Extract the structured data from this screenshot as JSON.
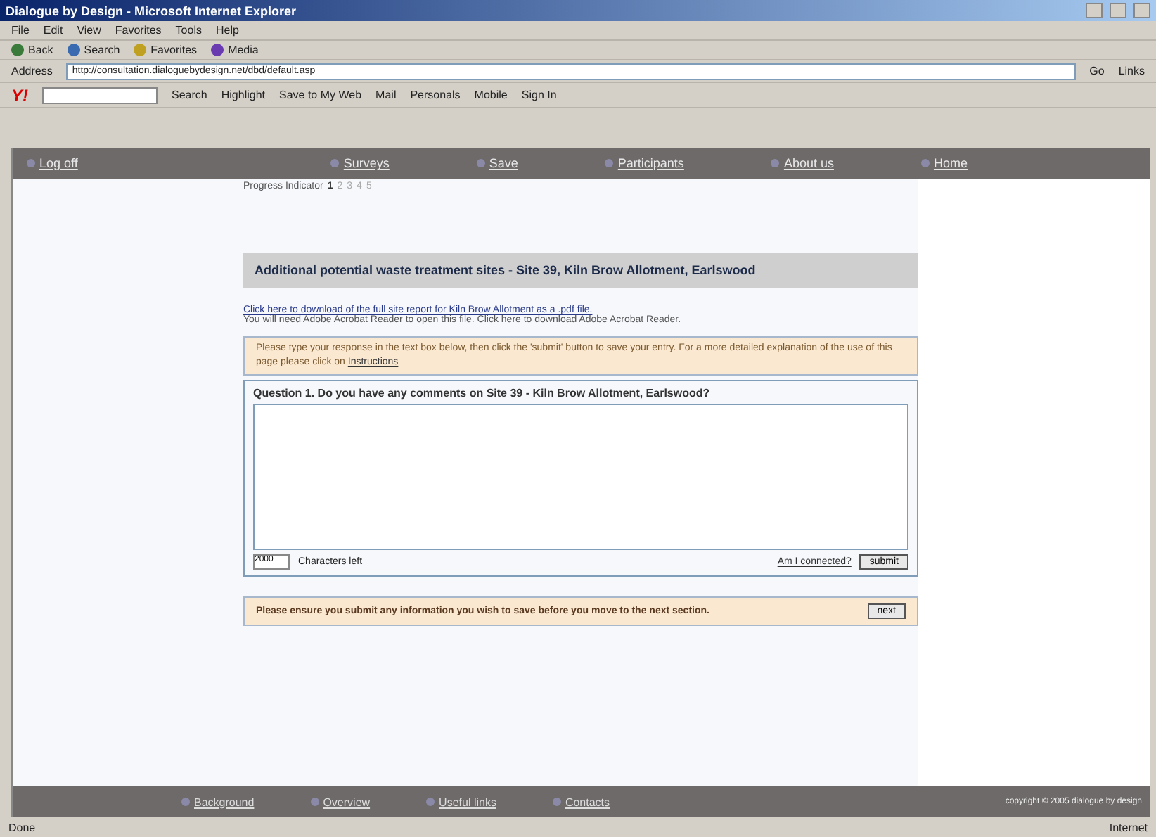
{
  "window": {
    "title": "Dialogue by Design - Microsoft Internet Explorer"
  },
  "menu": [
    "File",
    "Edit",
    "View",
    "Favorites",
    "Tools",
    "Help"
  ],
  "toolbar": [
    "Back",
    "Search",
    "Favorites",
    "Media"
  ],
  "address": {
    "label": "Address",
    "value": "http://consultation.dialoguebydesign.net/dbd/default.asp",
    "go": "Go",
    "links": "Links"
  },
  "yahoo_logo": "Y!",
  "yahoo_bar": [
    "Search",
    "Highlight",
    "Save to My Web",
    "Mail",
    "Personals",
    "Mobile",
    "Sign In"
  ],
  "nav": [
    "Log off",
    "Surveys",
    "Save",
    "Participants",
    "About us",
    "Home"
  ],
  "progress": {
    "label": "Progress Indicator",
    "steps": [
      {
        "label": "1",
        "selected": true
      },
      {
        "label": "2",
        "selected": false
      },
      {
        "label": "3",
        "selected": false
      },
      {
        "label": "4",
        "selected": false
      },
      {
        "label": "5",
        "selected": false
      }
    ]
  },
  "heading": "Additional potential waste treatment sites - Site 39, Kiln Brow Allotment, Earlswood",
  "download_link": "Click here to download of the full site report for Kiln Brow Allotment as a .pdf file.",
  "reader_note": "You will need Adobe Acrobat Reader to open this file. Click here to download Adobe Acrobat Reader.",
  "instructions": {
    "text": "Please type your response in the text box below, then click the 'submit' button to save your entry. For a more detailed explanation of the use of this page please click on",
    "link": "Instructions"
  },
  "question": {
    "text": "Question 1. Do you have any comments on Site 39 - Kiln Brow Allotment, Earlswood?",
    "counter": "2000",
    "counter_label": "Characters left",
    "connected_link": "Am I connected?",
    "submit": "submit"
  },
  "reminder": {
    "text": "Please ensure you submit any information you wish to save before you move to the next section.",
    "button": "next"
  },
  "footer": {
    "links": [
      "Background",
      "Overview",
      "Useful links",
      "Contacts"
    ],
    "copyright": "copyright © 2005 dialogue by design"
  },
  "status_bar": {
    "text": "Done",
    "zone": "Internet"
  }
}
